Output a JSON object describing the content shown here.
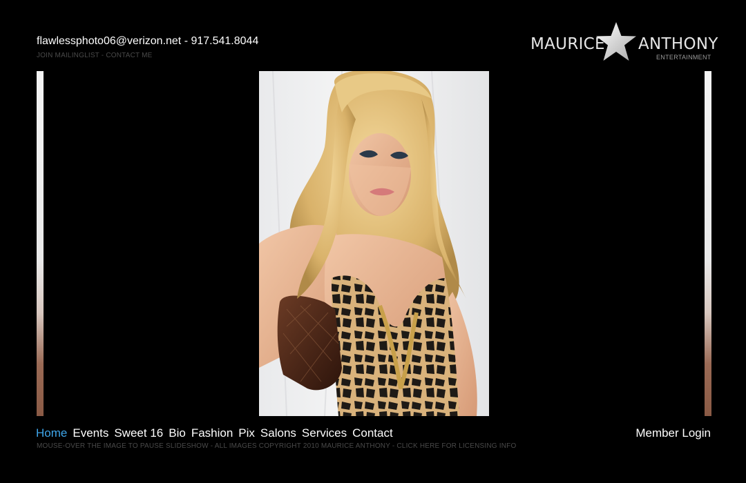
{
  "header": {
    "email": "flawlessphoto06@verizon.net",
    "separator": " - ",
    "phone": "917.541.8044",
    "join_mailinglist": "JOIN MAILINGLIST",
    "sub_separator": " - ",
    "contact_me": "CONTACT ME"
  },
  "logo": {
    "word_left": "MAURICE",
    "word_right": "ANTHONY",
    "tagline": "ENTERTAINMENT",
    "icon": "star-icon"
  },
  "slideshow": {
    "main_image": "portrait-photo"
  },
  "nav": {
    "items": [
      {
        "label": "Home",
        "active": true
      },
      {
        "label": "Events"
      },
      {
        "label": "Sweet 16"
      },
      {
        "label": "Bio"
      },
      {
        "label": "Fashion"
      },
      {
        "label": "Pix"
      },
      {
        "label": "Salons"
      },
      {
        "label": "Services"
      },
      {
        "label": "Contact"
      }
    ],
    "member_login": "Member Login"
  },
  "footer": {
    "note": "MOUSE-OVER THE IMAGE TO PAUSE SLIDESHOW - ALL IMAGES COPYRIGHT 2010 MAURICE ANTHONY - CLICK HERE FOR LICENSING INFO"
  },
  "colors": {
    "background": "#000000",
    "active_link": "#3fa6ea",
    "muted_text": "#4a4a4a"
  }
}
